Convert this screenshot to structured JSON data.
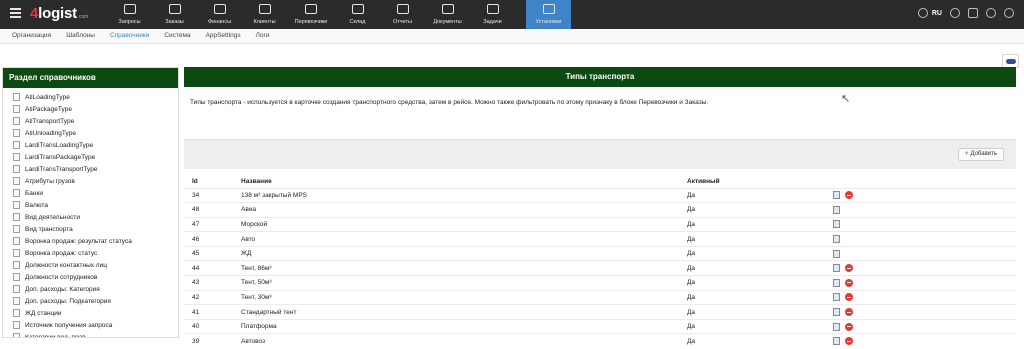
{
  "app": {
    "logo_digit": "4",
    "logo_text": "logist",
    "logo_suffix": ".com"
  },
  "nav": [
    {
      "label": "Запросы",
      "icon": "requests-icon"
    },
    {
      "label": "Заказы",
      "icon": "orders-icon"
    },
    {
      "label": "Финансы",
      "icon": "finance-icon"
    },
    {
      "label": "Клиенты",
      "icon": "clients-icon"
    },
    {
      "label": "Перевозчики",
      "icon": "truck-icon"
    },
    {
      "label": "Склад",
      "icon": "warehouse-icon"
    },
    {
      "label": "Отчеты",
      "icon": "reports-icon"
    },
    {
      "label": "Документы",
      "icon": "documents-icon"
    },
    {
      "label": "Задачи",
      "icon": "tasks-icon"
    },
    {
      "label": "Установки",
      "icon": "gear-icon",
      "active": true
    }
  ],
  "topbar_right": {
    "lang": "RU"
  },
  "subnav": [
    {
      "label": "Организация"
    },
    {
      "label": "Шаблоны"
    },
    {
      "label": "Справочники",
      "active": true
    },
    {
      "label": "Система"
    },
    {
      "label": "AppSettings"
    },
    {
      "label": "Логи"
    }
  ],
  "sidebar": {
    "title": "Раздел справочников",
    "items": [
      "AtiLoadingType",
      "AtiPackageType",
      "AtiTransportType",
      "AtiUnloadingType",
      "LardiTransLoadingType",
      "LardiTransPackageType",
      "LardiTransTransportType",
      "Атрибуты грузов",
      "Банки",
      "Валюта",
      "Вид деятельности",
      "Вид транспорта",
      "Воронка продаж: результат статуса",
      "Воронка продаж: статус",
      "Должности контактных лиц",
      "Должности сотрудников",
      "Доп. расходы: Категория",
      "Доп. расходы: Подкатегория",
      "ЖД станции",
      "Источник получения запроса",
      "Категории вод. прав"
    ]
  },
  "main": {
    "title": "Типы транспорта",
    "description": "Типы транспорта - используется в карточке создания транспортного средства, затем в рейсе. Можно также фильтровать по этому признаку в блоке Перевозчики и Заказы.",
    "add_button": "Добавить",
    "columns": {
      "id": "Id",
      "name": "Название",
      "active": "Активный"
    },
    "rows": [
      {
        "id": "34",
        "name": "138 м³ закрытый MPS",
        "active": "Да",
        "deletable": true
      },
      {
        "id": "48",
        "name": "Авиа",
        "active": "Да",
        "deletable": false
      },
      {
        "id": "47",
        "name": "Морской",
        "active": "Да",
        "deletable": false
      },
      {
        "id": "46",
        "name": "Авто",
        "active": "Да",
        "deletable": false
      },
      {
        "id": "45",
        "name": "ЖД",
        "active": "Да",
        "deletable": false
      },
      {
        "id": "44",
        "name": "Тент, 86м³",
        "active": "Да",
        "deletable": true
      },
      {
        "id": "43",
        "name": "Тент, 50м³",
        "active": "Да",
        "deletable": true
      },
      {
        "id": "42",
        "name": "Тент, 30м³",
        "active": "Да",
        "deletable": true
      },
      {
        "id": "41",
        "name": "Стандартный тент",
        "active": "Да",
        "deletable": true
      },
      {
        "id": "40",
        "name": "Платформа",
        "active": "Да",
        "deletable": true
      },
      {
        "id": "39",
        "name": "Автовоз",
        "active": "Да",
        "deletable": true
      }
    ]
  },
  "colors": {
    "topbar": "#2b2b2b",
    "active_nav": "#3f83c9",
    "panel_header": "#0d4a12",
    "delete": "#e53935",
    "add": "#43a047"
  }
}
